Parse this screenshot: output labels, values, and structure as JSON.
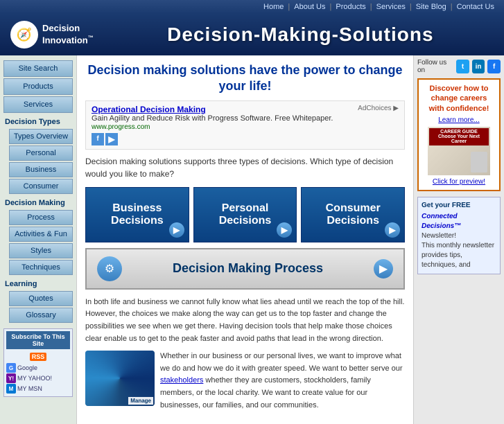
{
  "topnav": {
    "links": [
      "Home",
      "About Us",
      "Products",
      "Services",
      "Site Blog",
      "Contact Us"
    ]
  },
  "header": {
    "logo_line1": "Decision",
    "logo_line2": "Innovation",
    "site_title": "Decision-Making-Solutions"
  },
  "sidebar": {
    "top_links": [
      {
        "id": "site-search",
        "label": "Site Search"
      },
      {
        "id": "products",
        "label": "Products"
      },
      {
        "id": "services",
        "label": "Services"
      }
    ],
    "decision_types_title": "Decision Types",
    "decision_types_links": [
      {
        "id": "types-overview",
        "label": "Types Overview"
      },
      {
        "id": "personal",
        "label": "Personal"
      },
      {
        "id": "business",
        "label": "Business"
      },
      {
        "id": "consumer",
        "label": "Consumer"
      }
    ],
    "decision_making_title": "Decision Making",
    "decision_making_links": [
      {
        "id": "process",
        "label": "Process"
      },
      {
        "id": "activities-fun",
        "label": "Activities & Fun"
      },
      {
        "id": "styles",
        "label": "Styles"
      },
      {
        "id": "techniques",
        "label": "Techniques"
      }
    ],
    "learning_title": "Learning",
    "learning_links": [
      {
        "id": "quotes",
        "label": "Quotes"
      },
      {
        "id": "glossary",
        "label": "Glossary"
      }
    ],
    "subscribe_text": "Subscribe To This Site"
  },
  "main": {
    "heading": "Decision making solutions have the power to change your life!",
    "ad": {
      "link_text": "Operational Decision Making",
      "desc": "Gain Agility and Reduce Risk with Progress Software. Free Whitepaper.",
      "url": "www.progress.com",
      "ad_choices": "AdChoices ▶"
    },
    "intro_text": "Decision making solutions supports three types of decisions. Which type of decision would you like to make?",
    "decision_boxes": [
      {
        "id": "business",
        "label": "Business\nDecisions"
      },
      {
        "id": "personal",
        "label": "Personal\nDecisions"
      },
      {
        "id": "consumer",
        "label": "Consumer\nDecisions"
      }
    ],
    "process_button": "Decision Making Process",
    "body_paragraphs": [
      "In both life and business we cannot fully know what lies ahead until we reach the top of the hill. However, the choices we make along the way can get us to the top faster and change the possibilities we see when we get there. Having decision tools that help make those choices clear enable us to get to the peak faster and avoid paths that lead in the wrong direction.",
      "Whether in our business or our personal lives, we want to improve what we do and how we do it with greater speed. We want to better serve our stakeholders whether they are customers, stockholders, family members, or the local charity. We want to create value for our businesses, our families, and our communities."
    ],
    "stakeholders_link": "stakeholders",
    "frame_label": "Manage"
  },
  "right_sidebar": {
    "follow_us_label": "Follow us on",
    "ad_card": {
      "title": "Discover how to change careers with confidence!",
      "link": "Learn more...",
      "book_title": "CAREER GUIDE\nChoose Your Next Career",
      "click_preview": "Click for preview!"
    },
    "newsletter": {
      "get_free": "Get your FREE",
      "brand": "Connected Decisions™",
      "label": "Newsletter!",
      "desc": "This monthly newsletter provides tips, techniques, and"
    }
  }
}
